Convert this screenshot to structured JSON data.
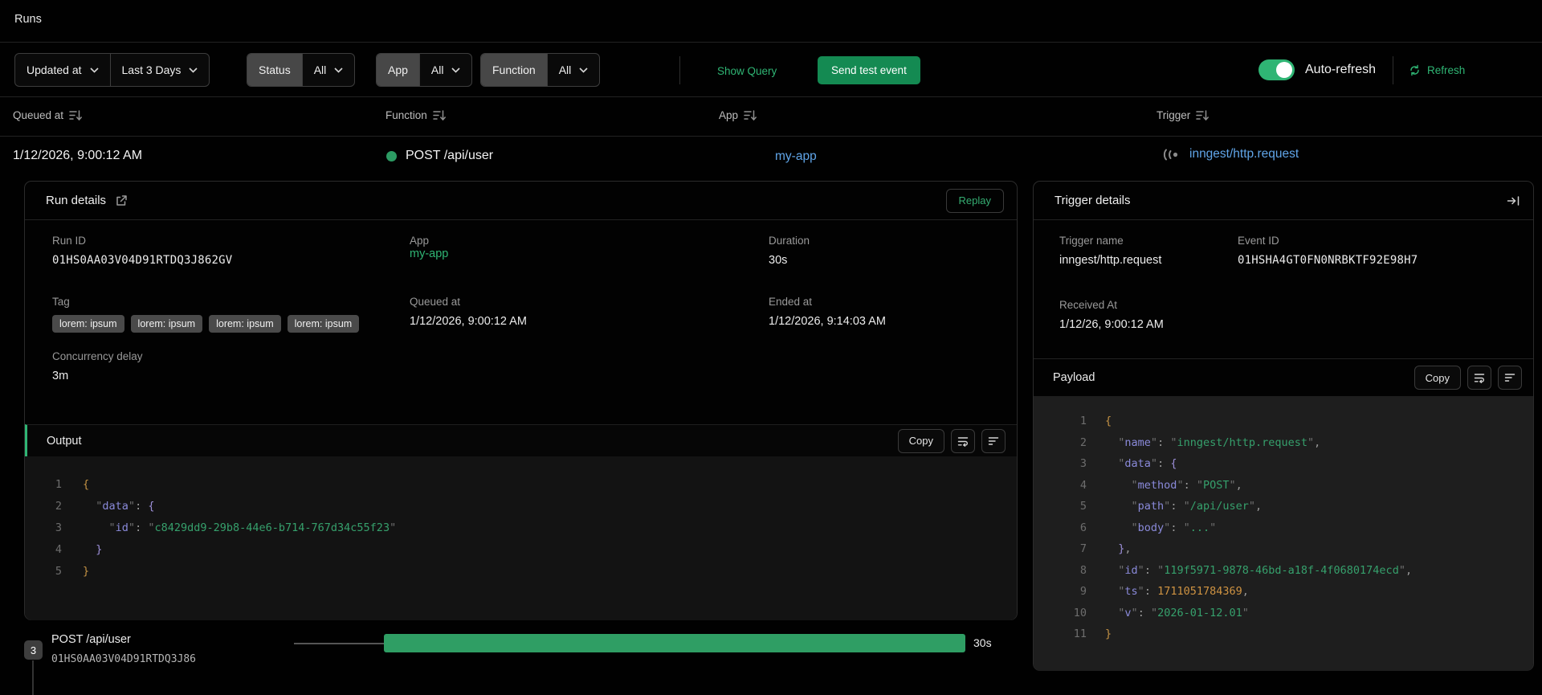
{
  "page": {
    "title": "Runs"
  },
  "colors": {
    "accent_green": "#2fb574",
    "button_green": "#148a52",
    "bar_green": "#2f9e64",
    "link_blue": "#60a5e8",
    "status_dot": "#2c9b63"
  },
  "filters": {
    "time_field": {
      "label": "Updated at"
    },
    "time_range": {
      "label": "Last 3 Days"
    },
    "status": {
      "label": "Status",
      "value": "All"
    },
    "app": {
      "label": "App",
      "value": "All"
    },
    "function": {
      "label": "Function",
      "value": "All"
    },
    "show_query": "Show Query",
    "send_test_event": "Send test event",
    "auto_refresh_label": "Auto-refresh",
    "auto_refresh_state": "on",
    "refresh": "Refresh"
  },
  "table": {
    "headers": [
      "Queued at",
      "Function",
      "App",
      "Trigger"
    ],
    "row": {
      "queued_at": "1/12/2026, 9:00:12 AM",
      "function": "POST /api/user",
      "app": "my-app",
      "trigger": "inngest/http.request"
    }
  },
  "run_details": {
    "title": "Run details",
    "replay": "Replay",
    "fields": {
      "run_id": {
        "label": "Run ID",
        "value": "01HS0AA03V04D91RTDQ3J862GV"
      },
      "app": {
        "label": "App",
        "value": "my-app"
      },
      "duration": {
        "label": "Duration",
        "value": "30s"
      },
      "tag": {
        "label": "Tag",
        "badges": [
          "lorem: ipsum",
          "lorem: ipsum",
          "lorem: ipsum",
          "lorem: ipsum"
        ]
      },
      "queued_at": {
        "label": "Queued at",
        "value": "1/12/2026, 9:00:12 AM"
      },
      "ended_at": {
        "label": "Ended at",
        "value": "1/12/2026, 9:14:03 AM"
      },
      "concurrency_delay": {
        "label": "Concurrency delay",
        "value": "3m"
      }
    },
    "output": {
      "title": "Output",
      "copy": "Copy",
      "code": [
        [
          [
            "b0",
            "{"
          ]
        ],
        [
          [
            "ws",
            "  "
          ],
          [
            "q",
            "\""
          ],
          [
            "k",
            "data"
          ],
          [
            "q",
            "\""
          ],
          [
            "p",
            ": "
          ],
          [
            "b1",
            "{"
          ]
        ],
        [
          [
            "ws",
            "    "
          ],
          [
            "q",
            "\""
          ],
          [
            "k",
            "id"
          ],
          [
            "q",
            "\""
          ],
          [
            "p",
            ": "
          ],
          [
            "q",
            "\""
          ],
          [
            "s",
            "c8429dd9-29b8-44e6-b714-767d34c55f23"
          ],
          [
            "q",
            "\""
          ]
        ],
        [
          [
            "ws",
            "  "
          ],
          [
            "b1",
            "}"
          ]
        ],
        [
          [
            "b0",
            "}"
          ]
        ]
      ]
    }
  },
  "trigger_details": {
    "title": "Trigger details",
    "fields": {
      "trigger_name": {
        "label": "Trigger name",
        "value": "inngest/http.request"
      },
      "event_id": {
        "label": "Event ID",
        "value": "01HSHA4GT0FN0NRBKTF92E98H7"
      },
      "received_at": {
        "label": "Received At",
        "value": "1/12/26, 9:00:12 AM"
      }
    },
    "payload": {
      "title": "Payload",
      "copy": "Copy",
      "code": [
        [
          [
            "b0",
            "{"
          ]
        ],
        [
          [
            "ws",
            "  "
          ],
          [
            "q",
            "\""
          ],
          [
            "k",
            "name"
          ],
          [
            "q",
            "\""
          ],
          [
            "p",
            ": "
          ],
          [
            "q",
            "\""
          ],
          [
            "s",
            "inngest/http.request"
          ],
          [
            "q",
            "\""
          ],
          [
            "p",
            ","
          ]
        ],
        [
          [
            "ws",
            "  "
          ],
          [
            "q",
            "\""
          ],
          [
            "k",
            "data"
          ],
          [
            "q",
            "\""
          ],
          [
            "p",
            ": "
          ],
          [
            "b1",
            "{"
          ]
        ],
        [
          [
            "ws",
            "    "
          ],
          [
            "q",
            "\""
          ],
          [
            "k",
            "method"
          ],
          [
            "q",
            "\""
          ],
          [
            "p",
            ": "
          ],
          [
            "q",
            "\""
          ],
          [
            "s",
            "POST"
          ],
          [
            "q",
            "\""
          ],
          [
            "p",
            ","
          ]
        ],
        [
          [
            "ws",
            "    "
          ],
          [
            "q",
            "\""
          ],
          [
            "k",
            "path"
          ],
          [
            "q",
            "\""
          ],
          [
            "p",
            ": "
          ],
          [
            "q",
            "\""
          ],
          [
            "s",
            "/api/user"
          ],
          [
            "q",
            "\""
          ],
          [
            "p",
            ","
          ]
        ],
        [
          [
            "ws",
            "    "
          ],
          [
            "q",
            "\""
          ],
          [
            "k",
            "body"
          ],
          [
            "q",
            "\""
          ],
          [
            "p",
            ": "
          ],
          [
            "q",
            "\""
          ],
          [
            "s",
            "..."
          ],
          [
            "q",
            "\""
          ]
        ],
        [
          [
            "ws",
            "  "
          ],
          [
            "b1",
            "}"
          ],
          [
            "p",
            ","
          ]
        ],
        [
          [
            "ws",
            "  "
          ],
          [
            "q",
            "\""
          ],
          [
            "k",
            "id"
          ],
          [
            "q",
            "\""
          ],
          [
            "p",
            ": "
          ],
          [
            "q",
            "\""
          ],
          [
            "s",
            "119f5971-9878-46bd-a18f-4f0680174ecd"
          ],
          [
            "q",
            "\""
          ],
          [
            "p",
            ","
          ]
        ],
        [
          [
            "ws",
            "  "
          ],
          [
            "q",
            "\""
          ],
          [
            "k",
            "ts"
          ],
          [
            "q",
            "\""
          ],
          [
            "p",
            ": "
          ],
          [
            "n",
            "1711051784369"
          ],
          [
            "p",
            ","
          ]
        ],
        [
          [
            "ws",
            "  "
          ],
          [
            "q",
            "\""
          ],
          [
            "k",
            "v"
          ],
          [
            "q",
            "\""
          ],
          [
            "p",
            ": "
          ],
          [
            "q",
            "\""
          ],
          [
            "s",
            "2026-01-12.01"
          ],
          [
            "q",
            "\""
          ]
        ],
        [
          [
            "b0",
            "}"
          ]
        ]
      ]
    }
  },
  "timeline": {
    "step_count": "3",
    "name": "POST /api/user",
    "run_id": "01HS0AA03V04D91RTDQ3J86",
    "duration": "30s"
  }
}
